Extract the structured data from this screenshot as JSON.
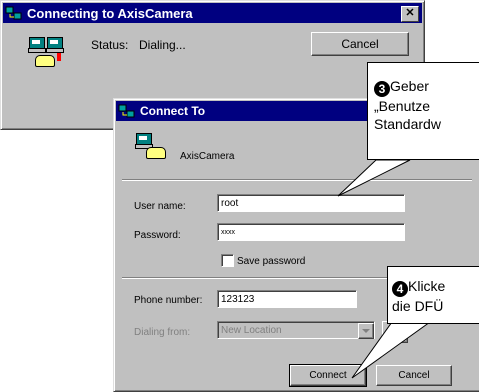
{
  "back_window": {
    "title": "Connecting to AxisCamera",
    "status_label": "Status:",
    "status_value": "Dialing...",
    "cancel_label": "Cancel"
  },
  "dialog": {
    "title": "Connect To",
    "connection_name": "AxisCamera",
    "user_name_label": "User name:",
    "user_name_value": "root",
    "password_label": "Password:",
    "password_value": "xxxx",
    "save_password_label": "Save password",
    "save_password_checked": false,
    "phone_number_label": "Phone number:",
    "phone_number_value": "123123",
    "dialing_from_label": "Dialing from:",
    "dialing_from_value": "New Location",
    "connect_label": "Connect",
    "cancel_label": "Cancel"
  },
  "callouts": {
    "step3_number": "3",
    "step3_line1": "Geber",
    "step3_line2": "„Benutze",
    "step3_line3": "Standardw",
    "step4_number": "4",
    "step4_line1": "Klicke",
    "step4_line2": "die DFÜ"
  },
  "colors": {
    "titlebar": "#000080",
    "window": "#c0c0c0"
  }
}
